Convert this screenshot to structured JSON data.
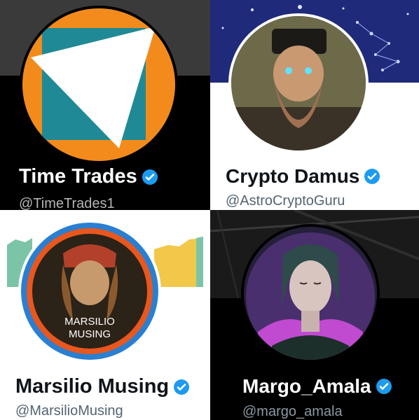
{
  "profiles": [
    {
      "display_name": "Time Trades",
      "handle": "@TimeTrades1",
      "verified": true
    },
    {
      "display_name": "Crypto Damus",
      "handle": "@AstroCryptoGuru",
      "verified": true
    },
    {
      "display_name": "Marsilio Musing",
      "handle": "@MarsilioMusing",
      "verified": true,
      "avatar_text": [
        "MARSILIO",
        "MUSING"
      ]
    },
    {
      "display_name": "Margo_Amala",
      "handle": "@margo_amala",
      "verified": true
    }
  ],
  "colors": {
    "verified_badge": "#1d9bf0",
    "time_trades_orange": "#f28b1c",
    "time_trades_teal": "#1f8a95",
    "astro_banner": "#1f2a7a",
    "marsilio_ring_orange": "#e8571e",
    "marsilio_ring_blue": "#2a7fd1",
    "margo_glow": "#c04ad0"
  },
  "icons": [
    "verified-badge-icon"
  ]
}
